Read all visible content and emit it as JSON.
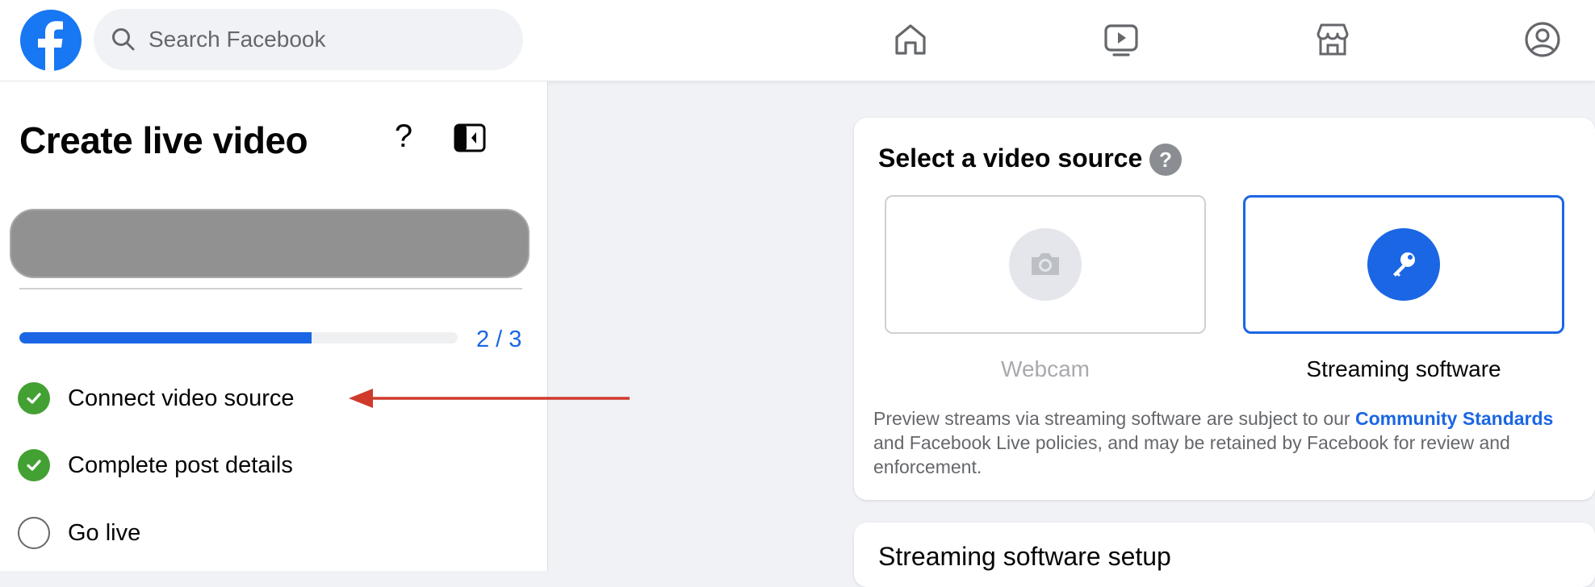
{
  "topbar": {
    "logo_icon": "facebook-logo",
    "search": {
      "placeholder": "Search Facebook",
      "icon": "search-icon"
    },
    "nav_icons": [
      "home-icon",
      "watch-icon",
      "marketplace-icon",
      "profile-icon"
    ]
  },
  "left_panel": {
    "title": "Create live video",
    "help_label": "?",
    "progress": {
      "fraction": 0.667,
      "count_text": "2 / 3"
    },
    "steps": [
      {
        "label": "Connect video source",
        "status": "complete"
      },
      {
        "label": "Complete post details",
        "status": "complete"
      },
      {
        "label": "Go live",
        "status": "pending"
      }
    ]
  },
  "video_source": {
    "title": "Select a video source",
    "info_label": "?",
    "options": [
      {
        "label": "Webcam",
        "icon": "camera-icon",
        "selected": false
      },
      {
        "label": "Streaming software",
        "icon": "key-icon",
        "selected": true
      }
    ],
    "notice": {
      "before": "Preview streams via streaming software are subject to our ",
      "link": "Community Standards",
      "after": " and Facebook Live policies, and may be retained by Facebook for review and enforcement."
    }
  },
  "setup": {
    "title": "Streaming software setup"
  },
  "colors": {
    "accent": "#1b66e4",
    "success": "#43a033",
    "annotation_arrow": "#d03a2b"
  }
}
